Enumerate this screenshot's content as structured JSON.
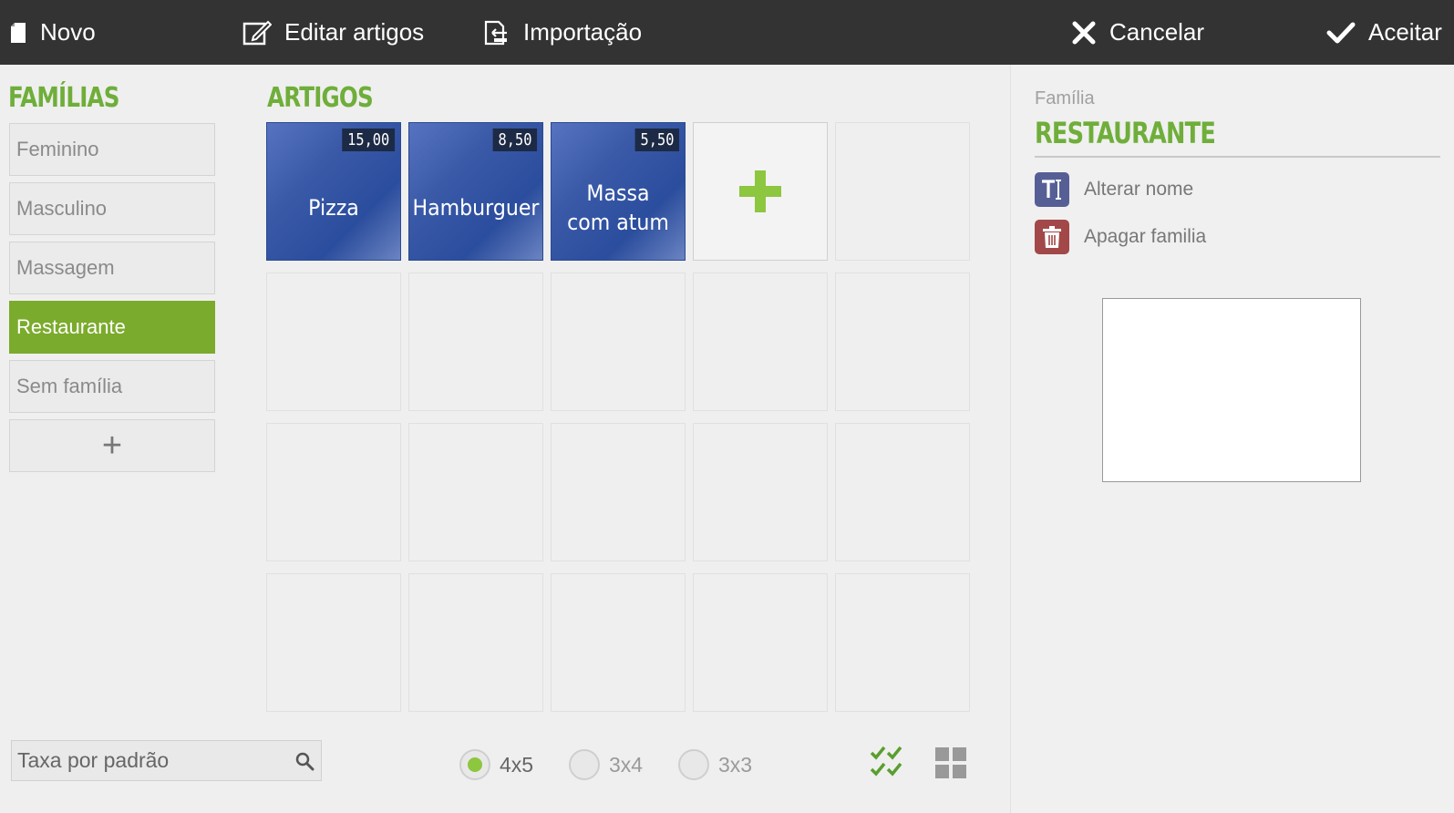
{
  "toolbar": {
    "new_label": "Novo",
    "edit_label": "Editar artigos",
    "import_label": "Importação",
    "cancel_label": "Cancelar",
    "accept_label": "Aceitar",
    "background": "#333333"
  },
  "families": {
    "title": "FAMÍLIAS",
    "items": [
      {
        "label": "Feminino",
        "active": false
      },
      {
        "label": "Masculino",
        "active": false
      },
      {
        "label": "Massagem",
        "active": false
      },
      {
        "label": "Restaurante",
        "active": true
      },
      {
        "label": "Sem família",
        "active": false
      }
    ],
    "add_label": "+"
  },
  "articles": {
    "title": "ARTIGOS",
    "items": [
      {
        "name": "Pizza",
        "price": "15,00"
      },
      {
        "name": "Hamburguer",
        "price": "8,50"
      },
      {
        "name": "Massa com atum",
        "price": "5,50"
      }
    ]
  },
  "bottom": {
    "search_placeholder": "Taxa por padrão",
    "grid_options": [
      {
        "label": "4x5",
        "selected": true
      },
      {
        "label": "3x4",
        "selected": false
      },
      {
        "label": "3x3",
        "selected": false
      }
    ]
  },
  "panel": {
    "label": "Família",
    "family_name": "RESTAURANTE",
    "rename_label": "Alterar nome",
    "delete_label": "Apagar familia"
  },
  "colors": {
    "accent_green": "#7bab2c",
    "heading_green": "#6fae3a",
    "article_blue": "#2b4d9d"
  }
}
